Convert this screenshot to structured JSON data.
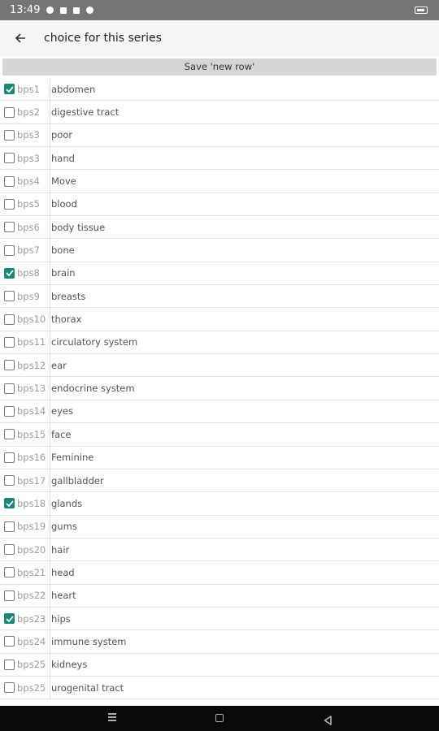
{
  "status_bar": {
    "time": "13:49"
  },
  "app_bar": {
    "title": "choice for this series"
  },
  "save_button_label": "Save 'new row'",
  "colors": {
    "accent": "#17897a",
    "status_bar": "#757575",
    "app_bar": "#f5f5f5",
    "nav_bar": "#0a0a0a"
  },
  "rows": [
    {
      "code": "bps1",
      "label": "abdomen",
      "checked": true
    },
    {
      "code": "bps2",
      "label": "digestive tract",
      "checked": false
    },
    {
      "code": "bps3",
      "label": "poor",
      "checked": false
    },
    {
      "code": "bps3",
      "label": "hand",
      "checked": false
    },
    {
      "code": "bps4",
      "label": "Move",
      "checked": false
    },
    {
      "code": "bps5",
      "label": "blood",
      "checked": false
    },
    {
      "code": "bps6",
      "label": "body tissue",
      "checked": false
    },
    {
      "code": "bps7",
      "label": "bone",
      "checked": false
    },
    {
      "code": "bps8",
      "label": "brain",
      "checked": true
    },
    {
      "code": "bps9",
      "label": "breasts",
      "checked": false
    },
    {
      "code": "bps10",
      "label": "thorax",
      "checked": false
    },
    {
      "code": "bps11",
      "label": "circulatory system",
      "checked": false
    },
    {
      "code": "bps12",
      "label": "ear",
      "checked": false
    },
    {
      "code": "bps13",
      "label": "endocrine system",
      "checked": false
    },
    {
      "code": "bps14",
      "label": "eyes",
      "checked": false
    },
    {
      "code": "bps15",
      "label": "face",
      "checked": false
    },
    {
      "code": "bps16",
      "label": "Feminine",
      "checked": false
    },
    {
      "code": "bps17",
      "label": "gallbladder",
      "checked": false
    },
    {
      "code": "bps18",
      "label": "glands",
      "checked": true
    },
    {
      "code": "bps19",
      "label": "gums",
      "checked": false
    },
    {
      "code": "bps20",
      "label": "hair",
      "checked": false
    },
    {
      "code": "bps21",
      "label": "head",
      "checked": false
    },
    {
      "code": "bps22",
      "label": "heart",
      "checked": false
    },
    {
      "code": "bps23",
      "label": "hips",
      "checked": true
    },
    {
      "code": "bps24",
      "label": "immune system",
      "checked": false
    },
    {
      "code": "bps25",
      "label": "kidneys",
      "checked": false
    },
    {
      "code": "bps25",
      "label": "urogenital tract",
      "checked": false
    }
  ]
}
